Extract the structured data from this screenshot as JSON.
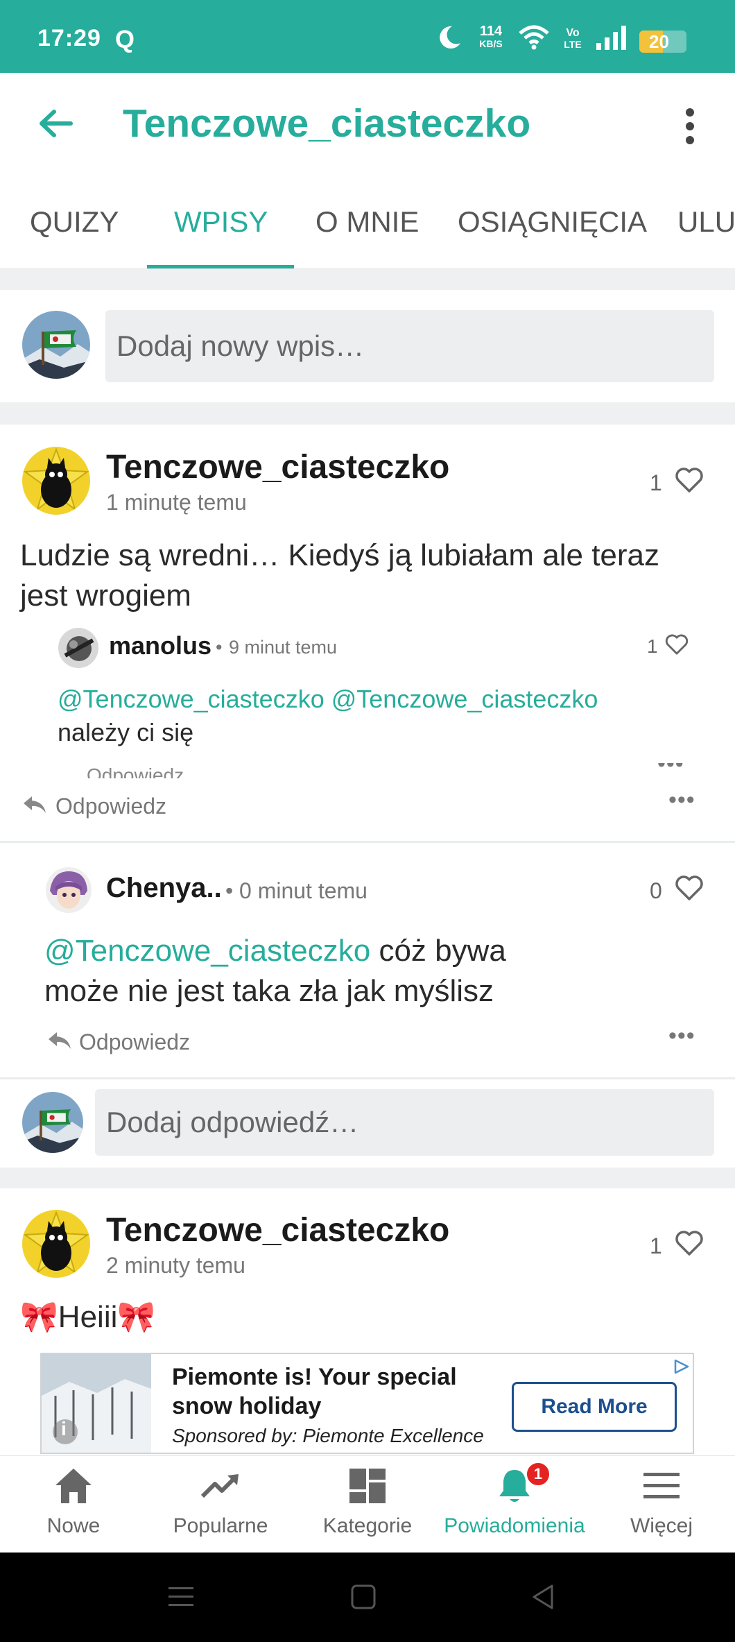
{
  "status_bar": {
    "time": "17:29",
    "q_icon": "Q",
    "net_speed_value": "114",
    "net_speed_unit": "KB/S",
    "volte_top": "Vo",
    "volte_bottom": "LTE",
    "battery": "20",
    "icons": [
      "moon-icon",
      "wifi-icon",
      "signal-icon",
      "battery-icon"
    ]
  },
  "app_bar": {
    "title": "Tenczowe_ciasteczko"
  },
  "tabs": [
    {
      "label": "QUIZY"
    },
    {
      "label": "WPISY",
      "active": true
    },
    {
      "label": "O MNIE"
    },
    {
      "label": "OSIĄGNIĘCIA"
    },
    {
      "label": "ULU"
    }
  ],
  "composer": {
    "placeholder": "Dodaj nowy wpis…"
  },
  "posts": [
    {
      "author": "Tenczowe_ciasteczko",
      "time": "1 minutę temu",
      "likes": "1",
      "text": "Ludzie są wredni… Kiedyś ją lubiałam ale teraz jest wrogiem",
      "reply_label": "Odpowiedz",
      "comments": [
        {
          "author": "manolus",
          "separator": "•",
          "time": "9 minut temu",
          "likes": "1",
          "mention_1": "@Tenczowe_ciasteczko",
          "mention_2": "@Tenczowe_ciasteczko",
          "text": "należy ci się",
          "reply_label": "Odpowiedz"
        },
        {
          "author": "Chenya..",
          "separator": "•",
          "time": "0 minut temu",
          "likes": "0",
          "mention": "@Tenczowe_ciasteczko",
          "text_after_mention": " cóż bywa",
          "text_line2": "może nie jest taka zła jak myślisz",
          "reply_label": "Odpowiedz"
        }
      ],
      "reply_placeholder": "Dodaj odpowiedź…"
    },
    {
      "author": "Tenczowe_ciasteczko",
      "time": "2 minuty temu",
      "likes": "1",
      "text": "Heiii",
      "emoji": "🎀"
    }
  ],
  "ad": {
    "headline": "Piemonte is! Your special snow holiday",
    "sponsor": "Sponsored by: Piemonte Excellence",
    "cta": "Read More",
    "info_icon": "i"
  },
  "bottom_nav": [
    {
      "label": "Nowe",
      "icon": "home-icon"
    },
    {
      "label": "Popularne",
      "icon": "trending-icon"
    },
    {
      "label": "Kategorie",
      "icon": "dashboard-icon"
    },
    {
      "label": "Powiadomienia",
      "icon": "bell-icon",
      "active": true,
      "badge": "1"
    },
    {
      "label": "Więcej",
      "icon": "menu-icon"
    }
  ],
  "colors": {
    "accent": "#26ad9b",
    "background_gap": "#eef0f1",
    "badge": "#e52222",
    "ad_cta": "#1c4f8f"
  }
}
